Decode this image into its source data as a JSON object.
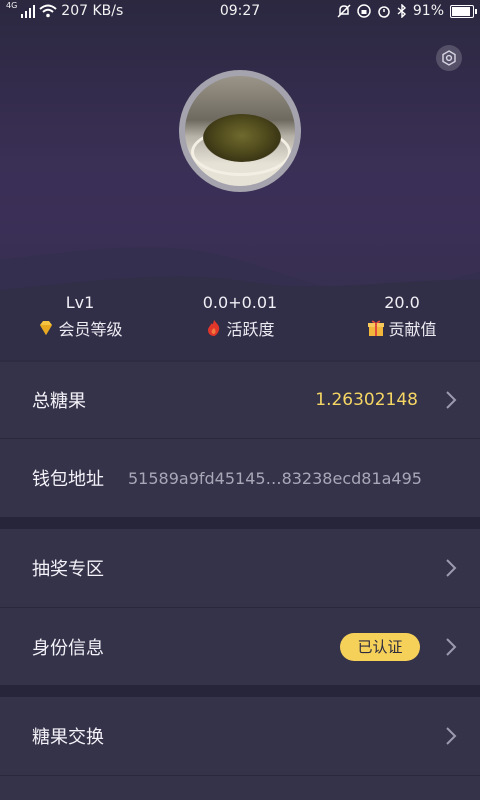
{
  "status_bar": {
    "network_type": "4G",
    "speed": "207 KB/s",
    "time": "09:27",
    "battery": "91%",
    "battery_level": 0.91
  },
  "profile": {
    "stats": [
      {
        "value": "Lv1",
        "label": "会员等级",
        "icon": "diamond-icon"
      },
      {
        "value": "0.0+0.01",
        "label": "活跃度",
        "icon": "flame-icon"
      },
      {
        "value": "20.0",
        "label": "贡献值",
        "icon": "gift-icon"
      }
    ]
  },
  "menu": {
    "total_candy": {
      "label": "总糖果",
      "value": "1.26302148"
    },
    "wallet": {
      "label": "钱包地址",
      "value": "51589a9fd45145…83238ecd81a495"
    },
    "lottery": {
      "label": "抽奖专区"
    },
    "identity": {
      "label": "身份信息",
      "badge": "已认证"
    },
    "exchange": {
      "label": "糖果交换"
    }
  },
  "colors": {
    "accent": "#f5d664",
    "badge_bg": "#f6d15a",
    "row_bg": "#353349",
    "hero_purple": "#3b2f57"
  }
}
